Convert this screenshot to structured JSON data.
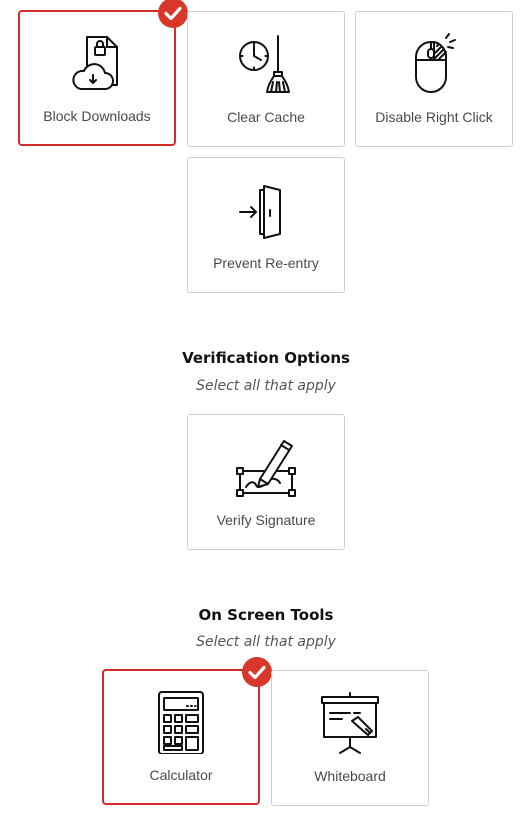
{
  "colors": {
    "selected_border": "#d62b2b",
    "check_badge": "#d9372a",
    "card_border": "#cfcfcf"
  },
  "security": {
    "cards": [
      {
        "label": "Block Downloads",
        "icon": "cloud-download-lock-icon",
        "selected": true
      },
      {
        "label": "Clear Cache",
        "icon": "clock-broom-icon",
        "selected": false
      },
      {
        "label": "Disable Right Click",
        "icon": "mouse-right-click-icon",
        "selected": false
      },
      {
        "label": "Prevent Re-entry",
        "icon": "door-enter-icon",
        "selected": false
      }
    ]
  },
  "verification": {
    "title": "Verification Options",
    "subtitle": "Select all that apply",
    "cards": [
      {
        "label": "Verify Signature",
        "icon": "signature-pen-icon",
        "selected": false
      }
    ]
  },
  "tools": {
    "title": "On Screen Tools",
    "subtitle": "Select all that apply",
    "cards": [
      {
        "label": "Calculator",
        "icon": "calculator-icon",
        "selected": true
      },
      {
        "label": "Whiteboard",
        "icon": "whiteboard-icon",
        "selected": false
      }
    ]
  }
}
